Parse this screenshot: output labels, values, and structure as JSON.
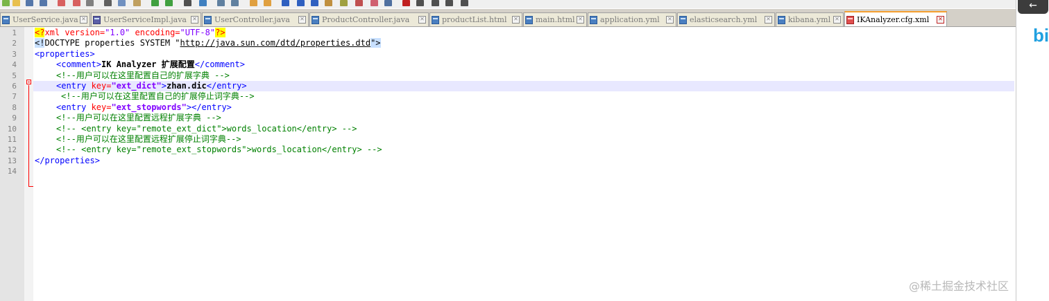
{
  "tabs": [
    {
      "label": "UserService.java",
      "icon": "java-file-icon",
      "active": false
    },
    {
      "label": "UserServiceImpl.java",
      "icon": "java-file-icon",
      "active": false
    },
    {
      "label": "UserController.java",
      "icon": "java-file-icon",
      "active": false
    },
    {
      "label": "ProductController.java",
      "icon": "java-file-icon",
      "active": false
    },
    {
      "label": "productList.html",
      "icon": "html-file-icon",
      "active": false
    },
    {
      "label": "main.html",
      "icon": "html-file-icon",
      "active": false
    },
    {
      "label": "application.yml",
      "icon": "yml-file-icon",
      "active": false
    },
    {
      "label": "elasticsearch.yml",
      "icon": "yml-file-icon",
      "active": false
    },
    {
      "label": "kibana.yml",
      "icon": "yml-file-icon",
      "active": false
    },
    {
      "label": "IKAnalyzer.cfg.xml",
      "icon": "xml-file-icon",
      "active": true
    }
  ],
  "editor": {
    "line_numbers": [
      "1",
      "2",
      "3",
      "4",
      "5",
      "6",
      "7",
      "8",
      "9",
      "10",
      "11",
      "12",
      "13",
      "14"
    ],
    "current_line": 6,
    "lines": {
      "l1": {
        "open": "<?",
        "xml": "xml ",
        "version_attr": "version=",
        "version_val": "\"1.0\"",
        "enc_attr": " encoding=",
        "enc_val": "\"UTF-8\"",
        "close": "?>"
      },
      "l2": {
        "open": "<!",
        "doctype": "DOCTYPE properties SYSTEM \"",
        "url": "http://java.sun.com/dtd/properties.dtd",
        "end": "\">"
      },
      "l3": {
        "tag": "<properties>"
      },
      "l4": {
        "open": "<comment>",
        "text": "IK Analyzer 扩展配置",
        "close": "</comment>"
      },
      "l5": {
        "comment": "<!--用户可以在这里配置自己的扩展字典 -->"
      },
      "l6": {
        "open": "<entry ",
        "attr": "key=",
        "val": "\"ext_dict\"",
        "gt": ">",
        "text": "zhan.dic",
        "close": "</entry>"
      },
      "l7": {
        "comment": "<!--用户可以在这里配置自己的扩展停止词字典-->"
      },
      "l8": {
        "open": "<entry ",
        "attr": "key=",
        "val": "\"ext_stopwords\"",
        "gt": ">",
        "close": "</entry>"
      },
      "l9": {
        "comment": "<!--用户可以在这里配置远程扩展字典 -->"
      },
      "l10": {
        "comment": "<!-- <entry key=\"remote_ext_dict\">words_location</entry> -->"
      },
      "l11": {
        "comment": "<!--用户可以在这里配置远程扩展停止词字典-->"
      },
      "l12": {
        "comment": "<!-- <entry key=\"remote_ext_stopwords\">words_location</entry> -->"
      },
      "l13": {
        "tag": "</properties>"
      }
    }
  },
  "right_panel": {
    "back_label": "←",
    "logo_text": "bi"
  },
  "watermark": "@稀土掘金技术社区",
  "colors": {
    "tag": "#0000ff",
    "attr": "#ff0000",
    "value": "#8000ff",
    "comment": "#008000",
    "active_tab_accent": "#f5a030"
  }
}
